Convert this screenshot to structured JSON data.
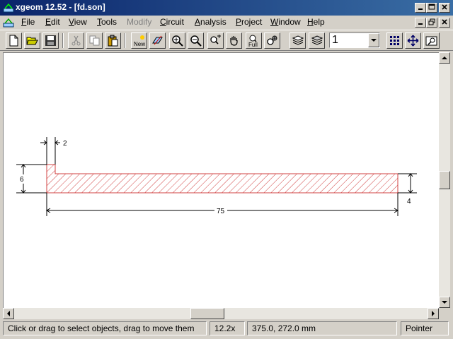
{
  "window": {
    "title": "xgeom 12.52 - [fd.son]",
    "controls": [
      "minimize",
      "maximize",
      "close"
    ],
    "doc_controls": [
      "minimize",
      "restore",
      "close"
    ]
  },
  "menu": [
    {
      "label": "File",
      "enabled": true
    },
    {
      "label": "Edit",
      "enabled": true
    },
    {
      "label": "View",
      "enabled": true
    },
    {
      "label": "Tools",
      "enabled": true
    },
    {
      "label": "Modify",
      "enabled": false
    },
    {
      "label": "Circuit",
      "enabled": true
    },
    {
      "label": "Analysis",
      "enabled": true
    },
    {
      "label": "Project",
      "enabled": true
    },
    {
      "label": "Window",
      "enabled": true
    },
    {
      "label": "Help",
      "enabled": true
    }
  ],
  "toolbar": {
    "new_label": "New",
    "full_label": "Full",
    "layer_value": "1"
  },
  "drawing": {
    "dim_top": "2",
    "dim_left": "6",
    "dim_right": "4",
    "dim_bottom": "75",
    "hatch_color": "#d04040"
  },
  "status": {
    "message": "Click or drag to select objects, drag to move them",
    "zoom": "12.2x",
    "coords": "375.0, 272.0 mm",
    "mode": "Pointer"
  }
}
